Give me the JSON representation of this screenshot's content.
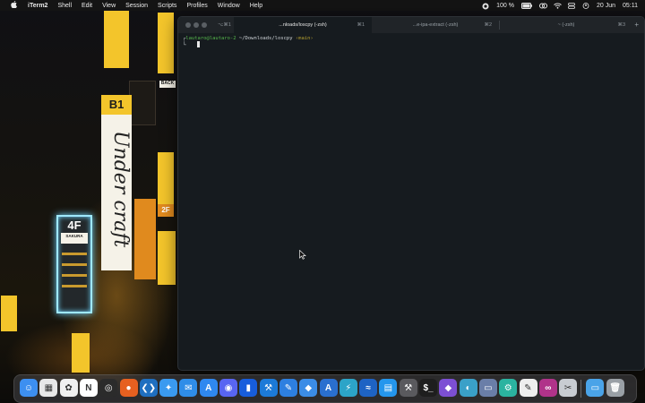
{
  "menubar": {
    "apple_icon": "apple-icon",
    "app_name": "iTerm2",
    "items": [
      "Shell",
      "Edit",
      "View",
      "Session",
      "Scripts",
      "Profiles",
      "Window",
      "Help"
    ],
    "battery": "100 %",
    "date": "20 Jun",
    "time": "05:11"
  },
  "wallpaper": {
    "signs": {
      "b1": "B1",
      "under_craft": "Under craft",
      "four_f": "4F",
      "sakura": "SAKURA",
      "two_f": "2F",
      "back": "BACK"
    }
  },
  "terminal": {
    "tabs": [
      {
        "shortcut": "⌥⌘1",
        "title": "",
        "active": false
      },
      {
        "shortcut": "⌘1",
        "title": "...nloads/loscpy (-zsh)",
        "active": true
      },
      {
        "shortcut": "⌘2",
        "title": "...e-ipa-extract (-zsh)",
        "active": false
      },
      {
        "shortcut": "⌘3",
        "title": "~ (-zsh)",
        "active": false
      }
    ],
    "new_tab": "+",
    "prompt": {
      "bracket": "┌",
      "user_host": "lautaro@lautaro-2",
      "path": "~/Downloads/loscpy",
      "branch": "‹main›",
      "line2": "└"
    }
  },
  "dock": {
    "apps": [
      {
        "name": "finder-icon",
        "color": "#3d8ff0",
        "glyph": "☺"
      },
      {
        "name": "launchpad-icon",
        "color": "#e8e8e8",
        "glyph": "▦"
      },
      {
        "name": "photos-icon",
        "color": "#f0f0f0",
        "glyph": "✿"
      },
      {
        "name": "notion-icon",
        "color": "#ffffff",
        "glyph": "N"
      },
      {
        "name": "chatgpt-icon",
        "color": "#2b2b2b",
        "glyph": "◎"
      },
      {
        "name": "firefox-icon",
        "color": "#e66020",
        "glyph": "●"
      },
      {
        "name": "vscode-icon",
        "color": "#1f6fc0",
        "glyph": "❮❯"
      },
      {
        "name": "safari-icon",
        "color": "#3a9af0",
        "glyph": "✦"
      },
      {
        "name": "mail-icon",
        "color": "#2f8de8",
        "glyph": "✉"
      },
      {
        "name": "app-store-icon",
        "color": "#2f88f0",
        "glyph": "A"
      },
      {
        "name": "discord-icon",
        "color": "#5865f2",
        "glyph": "◉"
      },
      {
        "name": "bitwarden-icon",
        "color": "#175ddc",
        "glyph": "▮"
      },
      {
        "name": "xcode-icon",
        "color": "#1c7ad8",
        "glyph": "⚒"
      },
      {
        "name": "pen-tool-icon",
        "color": "#2d7fe0",
        "glyph": "✎"
      },
      {
        "name": "simulator-icon",
        "color": "#3b8ce6",
        "glyph": "◆"
      },
      {
        "name": "instruments-icon",
        "color": "#2a6fcf",
        "glyph": "A"
      },
      {
        "name": "bolt-icon",
        "color": "#2ca4c8",
        "glyph": "⚡"
      },
      {
        "name": "wave-icon",
        "color": "#1e63c4",
        "glyph": "≈"
      },
      {
        "name": "docker-icon",
        "color": "#2496ed",
        "glyph": "▤"
      },
      {
        "name": "hammer-icon",
        "color": "#5a5a5e",
        "glyph": "⚒"
      },
      {
        "name": "terminal-icon",
        "color": "#1e1e1e",
        "glyph": "$_"
      },
      {
        "name": "obsidian-icon",
        "color": "#7c4fd4",
        "glyph": "◆"
      },
      {
        "name": "proxyman-icon",
        "color": "#3aa0c8",
        "glyph": "◐"
      },
      {
        "name": "screen-share-icon",
        "color": "#6a7ea8",
        "glyph": "▭"
      },
      {
        "name": "settings-gear-icon",
        "color": "#2bb3a0",
        "glyph": "⚙"
      },
      {
        "name": "textedit-icon",
        "color": "#eeeeee",
        "glyph": "✎"
      },
      {
        "name": "infinity-icon",
        "color": "#b0338a",
        "glyph": "∞"
      },
      {
        "name": "archive-utility-icon",
        "color": "#c8ccd2",
        "glyph": "✂"
      },
      {
        "name": "downloads-folder-icon",
        "color": "#4aa3e8",
        "glyph": "▭"
      },
      {
        "name": "trash-icon",
        "color": "#9aa0a6",
        "glyph": "🗑"
      }
    ]
  }
}
